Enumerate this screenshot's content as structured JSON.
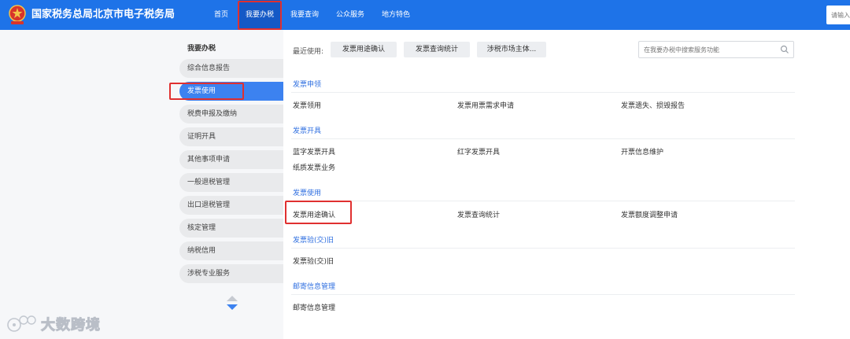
{
  "header": {
    "site_title": "国家税务总局北京市电子税务局",
    "nav": [
      "首页",
      "我要办税",
      "我要查询",
      "公众服务",
      "地方特色"
    ],
    "active_nav": "我要办税",
    "search_placeholder": "请输入",
    "colors": {
      "bar": "#1e73e8",
      "active": "#1459c6"
    }
  },
  "sidebar": {
    "title": "我要办税",
    "items": [
      "综合信息报告",
      "发票使用",
      "税费申报及缴纳",
      "证明开具",
      "其他事项申请",
      "一般退税管理",
      "出口退税管理",
      "核定管理",
      "纳税信用",
      "涉税专业服务"
    ],
    "active_item": "发票使用"
  },
  "recent": {
    "label": "最近使用:",
    "items": [
      "发票用途确认",
      "发票查询统计",
      "涉税市场主体..."
    ]
  },
  "service_search": {
    "placeholder": "在我要办税中搜索服务功能"
  },
  "sections": [
    {
      "title": "发票申领",
      "items": [
        "发票领用",
        "发票用票需求申请",
        "发票遗失、损毁报告"
      ]
    },
    {
      "title": "发票开具",
      "items": [
        "蓝字发票开具",
        "红字发票开具",
        "开票信息维护",
        "纸质发票业务"
      ]
    },
    {
      "title": "发票使用",
      "items": [
        "发票用途确认",
        "发票查询统计",
        "发票额度调整申请"
      ]
    },
    {
      "title": "发票验(交)旧",
      "items": [
        "发票验(交)旧"
      ]
    },
    {
      "title": "邮寄信息管理",
      "items": [
        "邮寄信息管理"
      ]
    }
  ],
  "watermark": {
    "text": "大数跨境"
  },
  "colors": {
    "accent": "#3c82f0",
    "highlight": "#e03030",
    "section_title": "#2f6fe0"
  }
}
